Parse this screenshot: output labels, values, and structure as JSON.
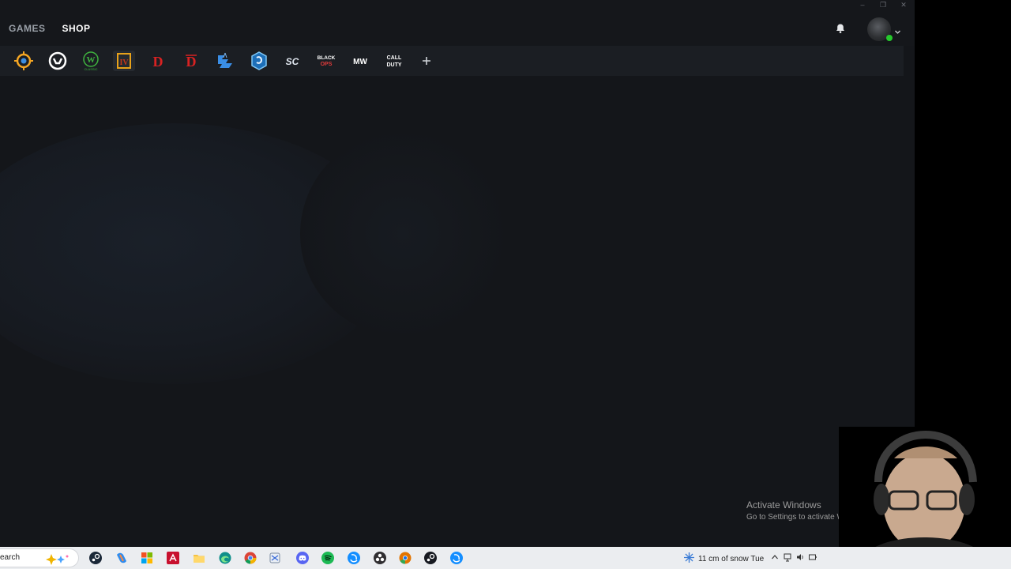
{
  "nav": {
    "games_label": "GAMES",
    "shop_label": "SHOP"
  },
  "window_controls": [
    "minimize-icon",
    "restore-icon",
    "close-icon"
  ],
  "header_icons": [
    "bell-icon",
    "avatar",
    "chevron-down-icon"
  ],
  "game_bar": {
    "icons": [
      {
        "name": "hearthstone-icon",
        "color": "#f5a623"
      },
      {
        "name": "overwatch-icon",
        "color": "#ffffff"
      },
      {
        "name": "wow-classic-icon",
        "color": "#3fb33f",
        "text": "W",
        "subtext": "CLASSIC"
      },
      {
        "name": "diablo-iv-icon",
        "color": "#e8a21a",
        "text": "IV"
      },
      {
        "name": "diablo-ii-icon",
        "color": "#d82222",
        "text": "D"
      },
      {
        "name": "diablo-iii-icon",
        "color": "#d82222",
        "text": "D"
      },
      {
        "name": "starcraft-ii-icon",
        "color": "#3a8ee6"
      },
      {
        "name": "heroes-of-the-storm-icon",
        "color": "#2aa3e6"
      },
      {
        "name": "starcraft-remastered-icon",
        "color": "#e0e6ef",
        "text": "SC"
      },
      {
        "name": "black-ops-icon",
        "color": "#e23b3b",
        "text": "BLACK",
        "subtext": "OPS"
      },
      {
        "name": "modern-warfare-icon",
        "color": "#ffffff",
        "text": "MW"
      },
      {
        "name": "call-of-duty-icon",
        "color": "#ffffff",
        "text": "CALL",
        "subtext": "DUTY"
      },
      {
        "name": "add-game-icon",
        "color": "#cfd3d8",
        "text": "+"
      }
    ]
  },
  "watermark": {
    "title": "Activate Windows",
    "subtitle": "Go to Settings to activate Windows."
  },
  "taskbar": {
    "search_text": "earch",
    "weather_text": "11 cm of snow Tue",
    "apps": [
      "copilot-sparkle-icon",
      "steam-icon",
      "copilot-icon",
      "microsoft-store-icon",
      "adobe-acrobat-icon",
      "file-explorer-icon",
      "edge-icon",
      "chrome-icon",
      "snipping-tool-icon",
      "discord-icon",
      "spotify-icon",
      "battle-net-icon",
      "obs-icon",
      "chrome-canary-icon",
      "steam-icon-2",
      "battle-net-icon-active"
    ],
    "tray": [
      "chevron-up-icon",
      "network-icon",
      "volume-icon",
      "battery-icon"
    ]
  },
  "colors": {
    "app_bg": "#14161a",
    "topbar_bg": "#15171b",
    "gamebar_bg": "#1b1e23",
    "status_online": "#26c92d",
    "taskbar_bg": "#ebedf0"
  }
}
